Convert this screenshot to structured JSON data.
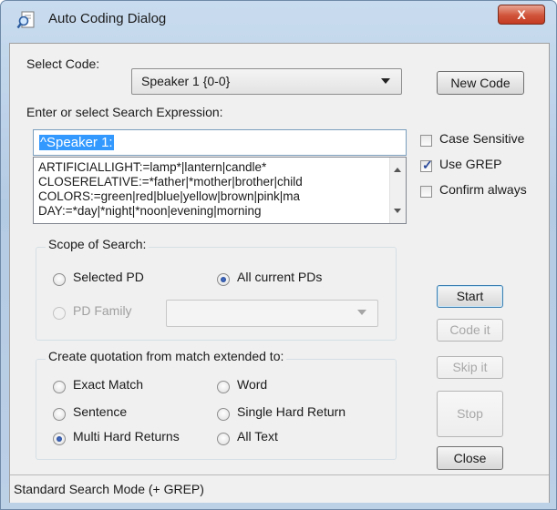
{
  "window": {
    "title": "Auto Coding Dialog",
    "close_glyph": "X"
  },
  "select_code": {
    "label": "Select Code:",
    "value": "Speaker 1 {0-0}"
  },
  "buttons": {
    "new_code": "New Code",
    "start": "Start",
    "code_it": "Code it",
    "skip_it": "Skip it",
    "stop": "Stop",
    "close": "Close"
  },
  "search": {
    "label": "Enter or select Search Expression:",
    "value": "^Speaker 1:",
    "list": [
      "ARTIFICIALLIGHT:=lamp*|lantern|candle*",
      "CLOSERELATIVE:=*father|*mother|brother|child",
      "COLORS:=green|red|blue|yellow|brown|pink|ma",
      "DAY:=*day|*night|*noon|evening|morning"
    ]
  },
  "options": {
    "case_sensitive": {
      "label": "Case Sensitive",
      "checked": false
    },
    "use_grep": {
      "label": "Use GREP",
      "checked": true
    },
    "confirm_always": {
      "label": "Confirm always",
      "checked": false
    }
  },
  "scope": {
    "title": "Scope of Search:",
    "selected_pd": "Selected PD",
    "all_current_pds": "All current PDs",
    "pd_family": "PD Family",
    "selected": "All current PDs"
  },
  "quotation": {
    "title": "Create quotation from match extended to:",
    "exact_match": "Exact Match",
    "word": "Word",
    "sentence": "Sentence",
    "single_hard_return": "Single Hard Return",
    "multi_hard_returns": "Multi Hard Returns",
    "all_text": "All Text",
    "selected": "Multi Hard Returns"
  },
  "status": {
    "text": "Standard Search Mode (+ GREP)"
  },
  "colors": {
    "selection": "#3399ff",
    "title_bar": "#c4d8ee",
    "close_button": "#d0543a"
  }
}
